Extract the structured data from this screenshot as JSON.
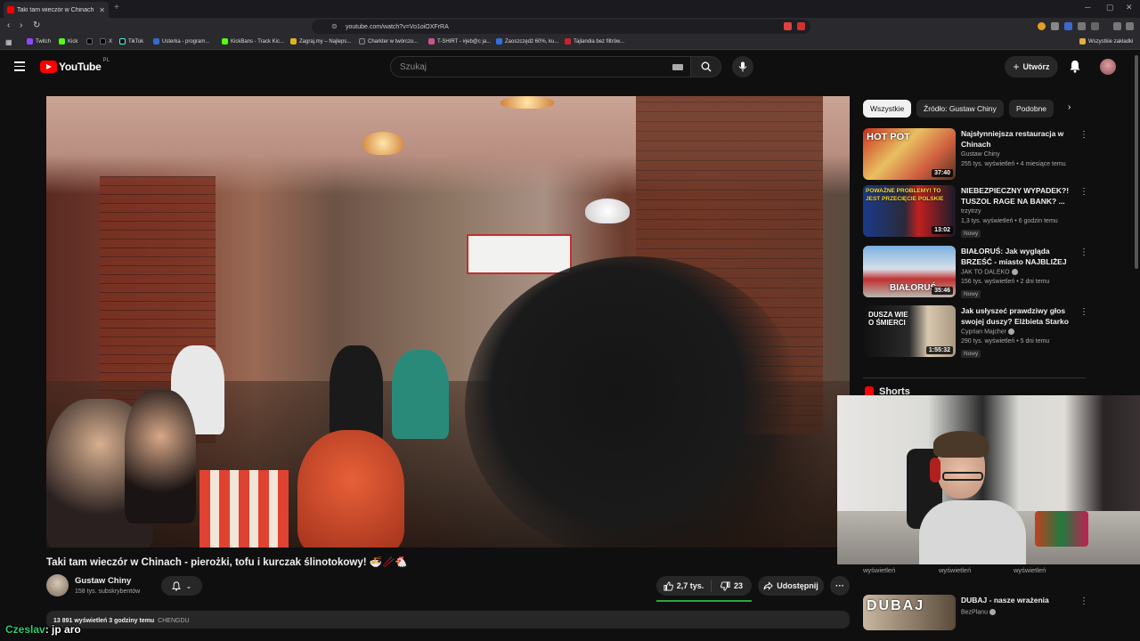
{
  "browser": {
    "tab_title": "Taki tam wieczór w Chinach",
    "url": "youtube.com/watch?v=Vo1oiOXFrRA",
    "bookmarks": [
      {
        "label": "Twitch",
        "color": "#9146ff"
      },
      {
        "label": "Kick",
        "color": "#53fc18"
      },
      {
        "label": "X",
        "color": "#000000"
      },
      {
        "label": "TikTok",
        "color": "#111111"
      },
      {
        "label": "Usterka - program...",
        "color": "#3a6ad0"
      },
      {
        "label": "KickBans - Track Kic...",
        "color": "#53fc18"
      },
      {
        "label": "Zagraj.my – Najleps...",
        "color": "#e0b020"
      },
      {
        "label": "Charkter w twórczo...",
        "color": "#333333"
      },
      {
        "label": "T-SHIRT - #jeb@c ja...",
        "color": "#d05090"
      },
      {
        "label": "Zaoszczędź 60%, ku...",
        "color": "#3070e0"
      },
      {
        "label": "Tajlandia bez filtrów...",
        "color": "#d02030"
      }
    ],
    "all_bookmarks_label": "Wszystkie zakładki"
  },
  "header": {
    "logo_text": "YouTube",
    "country_code": "PL",
    "search_placeholder": "Szukaj",
    "create_label": "Utwórz"
  },
  "video": {
    "title": "Taki tam wieczór w Chinach - pierożki, tofu i kurczak ślinotokowy! 🍜🥢🐔",
    "channel_name": "Gustaw Chiny",
    "subscribers": "158 tys. subskrybentów",
    "likes": "2,7 tys.",
    "dislikes": "23",
    "share_label": "Udostępnij",
    "description_stats": "13 891 wyświetleń  3 godziny temu",
    "description_tag": "CHENGDU"
  },
  "sidebar": {
    "chips": [
      {
        "label": "Wszystkie",
        "active": true
      },
      {
        "label": "Źródło: Gustaw Chiny",
        "active": false
      },
      {
        "label": "Podobne",
        "active": false
      }
    ],
    "recommendations": [
      {
        "title": "Najsłynniejsza restauracja w Chinach",
        "channel": "Gustaw Chiny",
        "meta": "255 tys. wyświetleń • 4 miesiące temu",
        "duration": "37:40",
        "thumb_text": "HOT POT",
        "badge": ""
      },
      {
        "title": "NIEBEZPIECZNY WYPADEK?! TUSZOL RAGE NA BANK? ...",
        "channel": "trzytrzy",
        "meta": "1,3 tys. wyświetleń • 6 godzin temu",
        "duration": "13:02",
        "thumb_text": "POWAŻNE PROBLEMY! TO JEST PRZECIĘCIE POLSKIE",
        "badge": "Nowy"
      },
      {
        "title": "BIAŁORUŚ: Jak wygląda BRZEŚĆ - miasto NAJBLIŻEJ ...",
        "channel": "JAK TO DALEKO",
        "meta": "156 tys. wyświetleń • 2 dni temu",
        "duration": "35:46",
        "thumb_text": "BIAŁORUŚ",
        "badge": "Nowy"
      },
      {
        "title": "Jak usłyszeć prawdziwy głos swojej duszy? Elżbieta Starko",
        "channel": "Cyprian Majcher",
        "meta": "290 tys. wyświetleń • 5 dni temu",
        "duration": "1:55:32",
        "thumb_text": "DUSZA WIE O ŚMIERCI",
        "badge": "Nowy"
      }
    ],
    "shorts_heading": "Shorts",
    "shorts_views": [
      "wyświetleń",
      "wyświetleń",
      "wyświetleń"
    ],
    "next_rec": {
      "title": "DUBAJ - nasze wrażenia",
      "channel": "BezPlanu",
      "thumb_text": "DUBAJ"
    }
  },
  "chat": {
    "username": "Czeslav",
    "message": ": jp aro"
  },
  "colors": {
    "youtube_red": "#ff0000",
    "like_bar": "#2ba640",
    "chat_user": "#2ecc71"
  }
}
